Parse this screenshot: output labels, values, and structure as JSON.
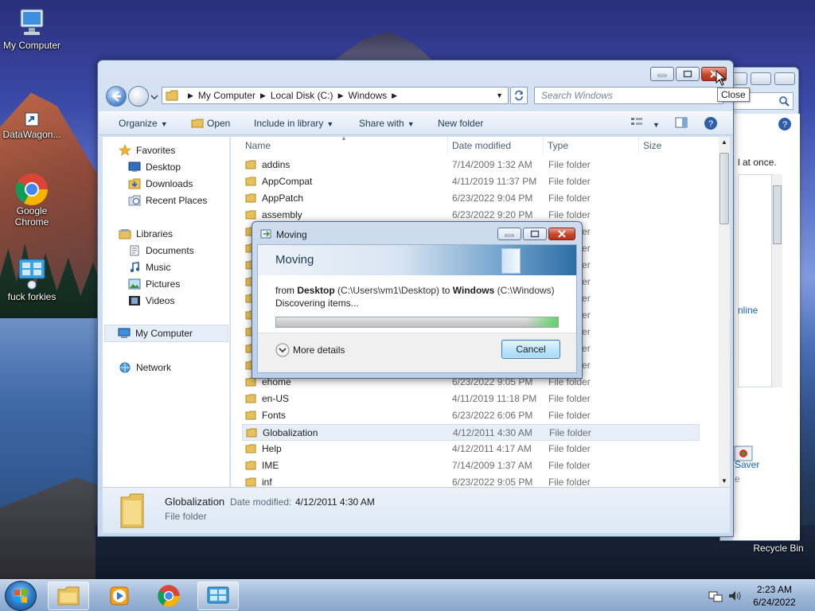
{
  "desktop": {
    "icons": [
      {
        "label": "My Computer",
        "icon": "computer-icon"
      },
      {
        "label": "DataWagon...",
        "icon": "shortcut-icon"
      },
      {
        "label": "Google Chrome",
        "icon": "chrome-icon"
      },
      {
        "label": "fuck forkies",
        "icon": "network-app-icon"
      }
    ],
    "recycle_bin": "Recycle Bin"
  },
  "bg_window": {
    "text1": "l at once.",
    "link1": "nline",
    "link2": "Saver",
    "text2": "e"
  },
  "explorer": {
    "address": {
      "crumbs": [
        "My Computer",
        "Local Disk (C:)",
        "Windows"
      ]
    },
    "search_placeholder": "Search Windows",
    "toolbar": {
      "organize": "Organize",
      "open": "Open",
      "include": "Include in library",
      "share": "Share with",
      "new_folder": "New folder"
    },
    "nav": {
      "favorites": "Favorites",
      "desktop": "Desktop",
      "downloads": "Downloads",
      "recent": "Recent Places",
      "libraries": "Libraries",
      "documents": "Documents",
      "music": "Music",
      "pictures": "Pictures",
      "videos": "Videos",
      "computer": "My Computer",
      "network": "Network"
    },
    "columns": {
      "name": "Name",
      "date": "Date modified",
      "type": "Type",
      "size": "Size"
    },
    "rows": [
      {
        "name": "addins",
        "date": "7/14/2009 1:32 AM",
        "type": "File folder"
      },
      {
        "name": "AppCompat",
        "date": "4/11/2019 11:37 PM",
        "type": "File folder"
      },
      {
        "name": "AppPatch",
        "date": "6/23/2022 9:04 PM",
        "type": "File folder"
      },
      {
        "name": "assembly",
        "date": "6/23/2022 9:20 PM",
        "type": "File folder"
      },
      {
        "name": "",
        "date": "",
        "type": "File folder"
      },
      {
        "name": "",
        "date": "",
        "type": "File folder"
      },
      {
        "name": "",
        "date": "",
        "type": "File folder"
      },
      {
        "name": "",
        "date": "",
        "type": "File folder"
      },
      {
        "name": "",
        "date": "",
        "type": "File folder"
      },
      {
        "name": "",
        "date": "",
        "type": "File folder"
      },
      {
        "name": "",
        "date": "",
        "type": "File folder"
      },
      {
        "name": "",
        "date": "",
        "type": "File folder"
      },
      {
        "name": "",
        "date": "",
        "type": "File folder"
      },
      {
        "name": "ehome",
        "date": "6/23/2022 9:05 PM",
        "type": "File folder"
      },
      {
        "name": "en-US",
        "date": "4/11/2019 11:18 PM",
        "type": "File folder"
      },
      {
        "name": "Fonts",
        "date": "6/23/2022 6:06 PM",
        "type": "File folder"
      },
      {
        "name": "Globalization",
        "date": "4/12/2011 4:30 AM",
        "type": "File folder",
        "selected": true
      },
      {
        "name": "Help",
        "date": "4/12/2011 4:17 AM",
        "type": "File folder"
      },
      {
        "name": "IME",
        "date": "7/14/2009 1:37 AM",
        "type": "File folder"
      },
      {
        "name": "inf",
        "date": "6/23/2022 9:05 PM",
        "type": "File folder"
      }
    ],
    "details": {
      "name": "Globalization",
      "date_label": "Date modified:",
      "date_value": "4/12/2011 4:30 AM",
      "type": "File folder"
    },
    "tooltip": "Close"
  },
  "moving_dialog": {
    "title": "Moving",
    "heading": "Moving",
    "from_label": "from",
    "from_name": "Desktop",
    "from_path": "(C:\\Users\\vm1\\Desktop)",
    "to_label": "to",
    "to_name": "Windows",
    "to_path": "(C:\\Windows)",
    "status": "Discovering items...",
    "progress": 1.0,
    "more_details": "More details",
    "cancel": "Cancel"
  },
  "taskbar": {
    "time": "2:23 AM",
    "date": "6/24/2022"
  },
  "colors": {
    "accent": "#2f7bc4",
    "close_red": "#c9442b",
    "progress_green": "#62d36a",
    "link_blue": "#1565c0"
  }
}
